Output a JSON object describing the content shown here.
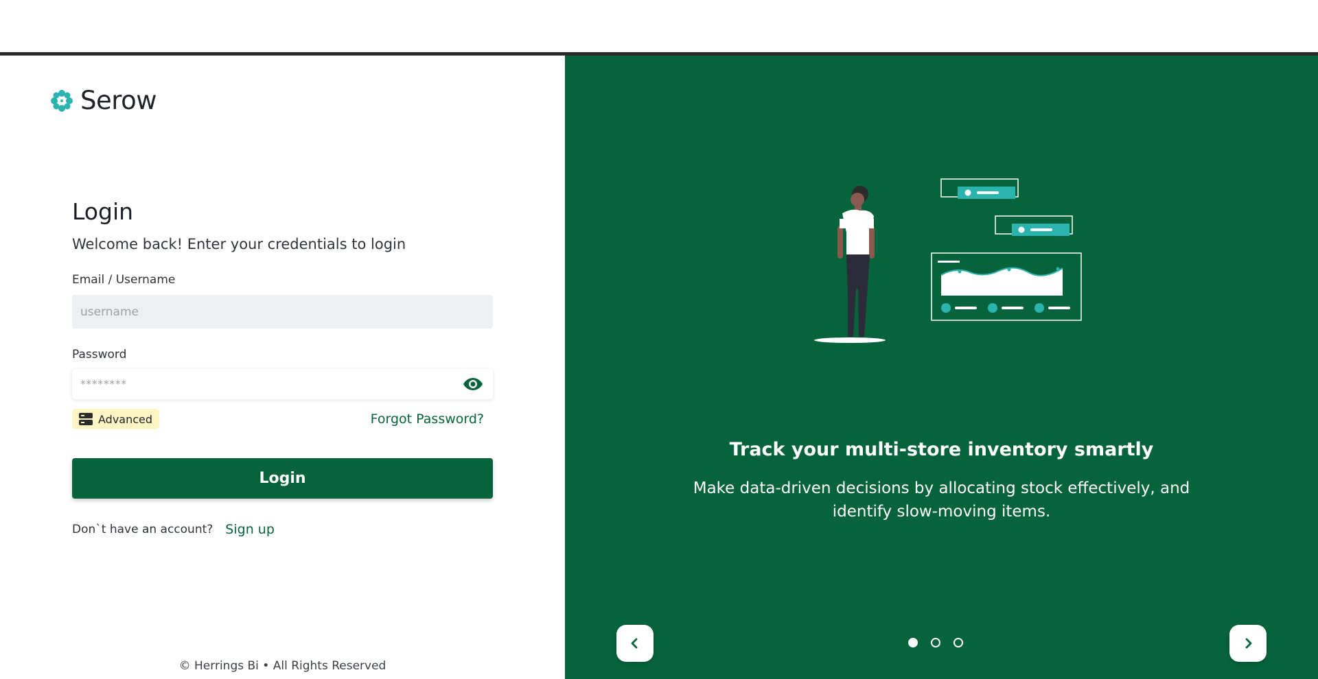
{
  "brand": {
    "name": "Serow",
    "icon": "flower-logo-icon"
  },
  "login": {
    "title": "Login",
    "subtitle": "Welcome back! Enter your credentials to login",
    "email_label": "Email / Username",
    "email_placeholder": "username",
    "password_label": "Password",
    "password_placeholder": "********",
    "advanced_label": "Advanced",
    "forgot_label": "Forgot Password?",
    "submit_label": "Login",
    "signup_question": "Don`t have an account?",
    "signup_label": "Sign up"
  },
  "footer": {
    "text": "© Herrings Bi • All Rights Reserved"
  },
  "carousel": {
    "title": "Track your multi-store inventory smartly",
    "text": "Make data-driven decisions by allocating stock effectively, and identify slow-moving items.",
    "active_index": 0,
    "slide_count": 3
  },
  "colors": {
    "primary": "#07633c",
    "accent": "#2bb3ad",
    "input_bg": "#edf0f3",
    "advanced_bg": "#fdf5c4"
  }
}
